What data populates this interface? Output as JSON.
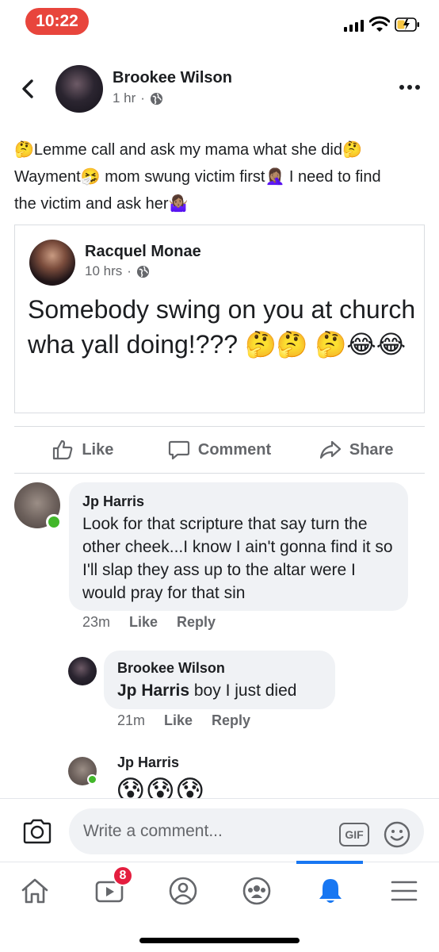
{
  "status_bar": {
    "time": "10:22"
  },
  "post": {
    "author": "Brookee Wilson",
    "time": "1 hr",
    "dot": "·",
    "text_lines": [
      {
        "e1": "🤔",
        "t": "Lemme call and ask my mama what she did",
        "e2": "🤔"
      },
      {
        "t1": "Wayment",
        "e1": "🤧",
        "t2": " mom swung victim first",
        "e2": "🤦🏽‍♀️",
        "t3": " I need to find"
      },
      {
        "t": "the victim and ask her",
        "e1": "🤷🏽‍♀️"
      }
    ]
  },
  "shared_post": {
    "author": "Racquel Monae",
    "time": "10 hrs",
    "dot": "·",
    "text": "Somebody swing on you at church wha yall doing!??? 🤔🤔 🤔😂😂"
  },
  "actions": {
    "like": "Like",
    "comment": "Comment",
    "share": "Share"
  },
  "comments": [
    {
      "author": "Jp Harris",
      "text": "Look for that scripture that say turn the other cheek...I know I ain't gonna find it so I'll slap they ass up to the altar were I would pray for that sin",
      "time": "23m",
      "like": "Like",
      "reply": "Reply"
    },
    {
      "author": "Brookee Wilson",
      "mention": "Jp Harris",
      "text": " boy I just died",
      "time": "21m",
      "like": "Like",
      "reply": "Reply"
    },
    {
      "author": "Jp Harris",
      "text": "😰😰😰"
    }
  ],
  "composer": {
    "placeholder": "Write a comment...",
    "gif": "GIF"
  },
  "bottom_nav": {
    "watch_badge": "8"
  },
  "colors": {
    "accent": "#1877f2",
    "online": "#42b72a",
    "badge": "#e41e3f",
    "time_pill": "#e8453c"
  }
}
